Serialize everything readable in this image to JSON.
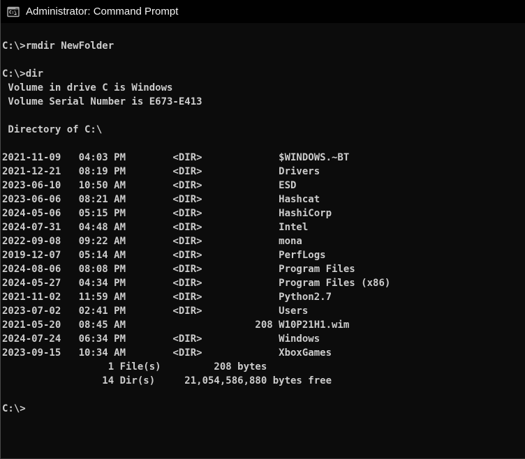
{
  "window": {
    "title": "Administrator: Command Prompt",
    "icon": "cmd-icon"
  },
  "console": {
    "history": [
      {
        "kind": "command",
        "text": "C:\\>rmdir NewFolder"
      },
      {
        "kind": "blank",
        "text": ""
      },
      {
        "kind": "command",
        "text": "C:\\>dir"
      },
      {
        "kind": "output",
        "text": " Volume in drive C is Windows"
      },
      {
        "kind": "output",
        "text": " Volume Serial Number is E673-E413"
      },
      {
        "kind": "blank",
        "text": ""
      },
      {
        "kind": "output",
        "text": " Directory of C:\\"
      },
      {
        "kind": "blank",
        "text": ""
      }
    ],
    "listing": [
      {
        "date": "2021-11-09",
        "time": "04:03 PM",
        "size": null,
        "name": "$WINDOWS.~BT"
      },
      {
        "date": "2021-12-21",
        "time": "08:19 PM",
        "size": null,
        "name": "Drivers"
      },
      {
        "date": "2023-06-10",
        "time": "10:50 AM",
        "size": null,
        "name": "ESD"
      },
      {
        "date": "2023-06-06",
        "time": "08:21 AM",
        "size": null,
        "name": "Hashcat"
      },
      {
        "date": "2024-05-06",
        "time": "05:15 PM",
        "size": null,
        "name": "HashiCorp"
      },
      {
        "date": "2024-07-31",
        "time": "04:48 AM",
        "size": null,
        "name": "Intel"
      },
      {
        "date": "2022-09-08",
        "time": "09:22 AM",
        "size": null,
        "name": "mona"
      },
      {
        "date": "2019-12-07",
        "time": "05:14 AM",
        "size": null,
        "name": "PerfLogs"
      },
      {
        "date": "2024-08-06",
        "time": "08:08 PM",
        "size": null,
        "name": "Program Files"
      },
      {
        "date": "2024-05-27",
        "time": "04:34 PM",
        "size": null,
        "name": "Program Files (x86)"
      },
      {
        "date": "2021-11-02",
        "time": "11:59 AM",
        "size": null,
        "name": "Python2.7"
      },
      {
        "date": "2023-07-02",
        "time": "02:41 PM",
        "size": null,
        "name": "Users"
      },
      {
        "date": "2021-05-20",
        "time": "08:45 AM",
        "size": "208",
        "name": "W10P21H1.wim"
      },
      {
        "date": "2024-07-24",
        "time": "06:34 PM",
        "size": null,
        "name": "Windows"
      },
      {
        "date": "2023-09-15",
        "time": "10:34 AM",
        "size": null,
        "name": "XboxGames"
      }
    ],
    "dir_marker": "<DIR>",
    "summary": {
      "file_count": "1",
      "file_label": "File(s)",
      "file_bytes": "208",
      "bytes_label": "bytes",
      "dir_count": "14",
      "dir_label": "Dir(s)",
      "free_bytes": "21,054,586,880",
      "free_label": "bytes free"
    },
    "final_prompt": "C:\\>"
  }
}
